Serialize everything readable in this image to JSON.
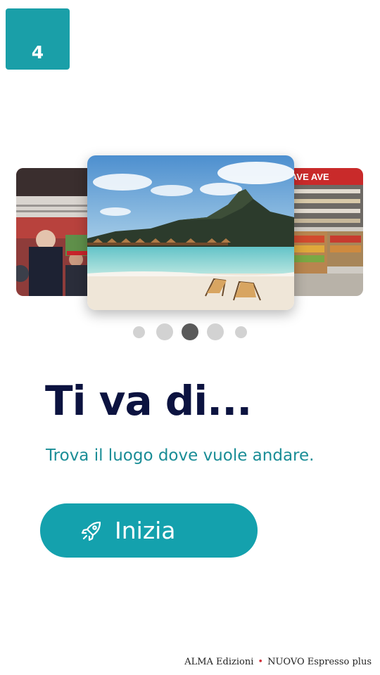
{
  "badge": {
    "text": "4"
  },
  "carousel": {
    "images": [
      {
        "name": "stadium",
        "position": "left"
      },
      {
        "name": "tropical-beach",
        "position": "center"
      },
      {
        "name": "supermarket",
        "position": "right"
      }
    ],
    "dots": {
      "count": 5,
      "active_index": 2
    }
  },
  "main": {
    "title": "Ti va di...",
    "subtitle": "Trova il luogo dove vuole andare.",
    "start_button": {
      "label": "Inizia",
      "icon": "rocket-icon"
    }
  },
  "footer": {
    "publisher": "ALMA Edizioni",
    "separator": "•",
    "book": "NUOVO Espresso plus"
  },
  "colors": {
    "accent": "#14a1ad",
    "badge": "#1a9fa8",
    "title": "#0c1340",
    "subtitle": "#1a8d96",
    "dot_active": "#5a5a5a",
    "dot_inactive": "#d2d2d2"
  }
}
